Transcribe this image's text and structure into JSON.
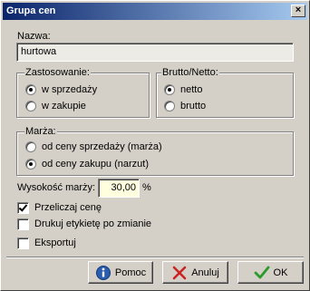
{
  "window": {
    "title": "Grupa cen",
    "close_glyph": "×"
  },
  "nazwa": {
    "label": "Nazwa:",
    "value": "hurtowa"
  },
  "zastosowanie": {
    "title": "Zastosowanie:",
    "options": [
      {
        "label": "w sprzedaży",
        "checked": true
      },
      {
        "label": "w zakupie",
        "checked": false
      }
    ]
  },
  "bruttonetto": {
    "title": "Brutto/Netto:",
    "options": [
      {
        "label": "netto",
        "checked": true
      },
      {
        "label": "brutto",
        "checked": false
      }
    ]
  },
  "marza": {
    "title": "Marża:",
    "options": [
      {
        "label": "od ceny sprzedaży (marża)",
        "checked": false
      },
      {
        "label": "od ceny zakupu (narzut)",
        "checked": true
      }
    ]
  },
  "wysokosc": {
    "label": "Wysokość marży:",
    "value": "30,00",
    "unit": "%"
  },
  "checkboxes": [
    {
      "label": "Przeliczaj cenę",
      "checked": true
    },
    {
      "label": "Drukuj etykietę po zmianie",
      "checked": false
    },
    {
      "label": "Eksportuj",
      "checked": false
    }
  ],
  "buttons": {
    "help": {
      "label": "Pomoc",
      "icon": "info-icon",
      "color": "#2a5db0"
    },
    "cancel": {
      "label": "Anuluj",
      "icon": "x-icon",
      "color": "#cc2222"
    },
    "ok": {
      "label": "OK",
      "icon": "checkmark-icon",
      "color": "#2a9a2a"
    }
  }
}
